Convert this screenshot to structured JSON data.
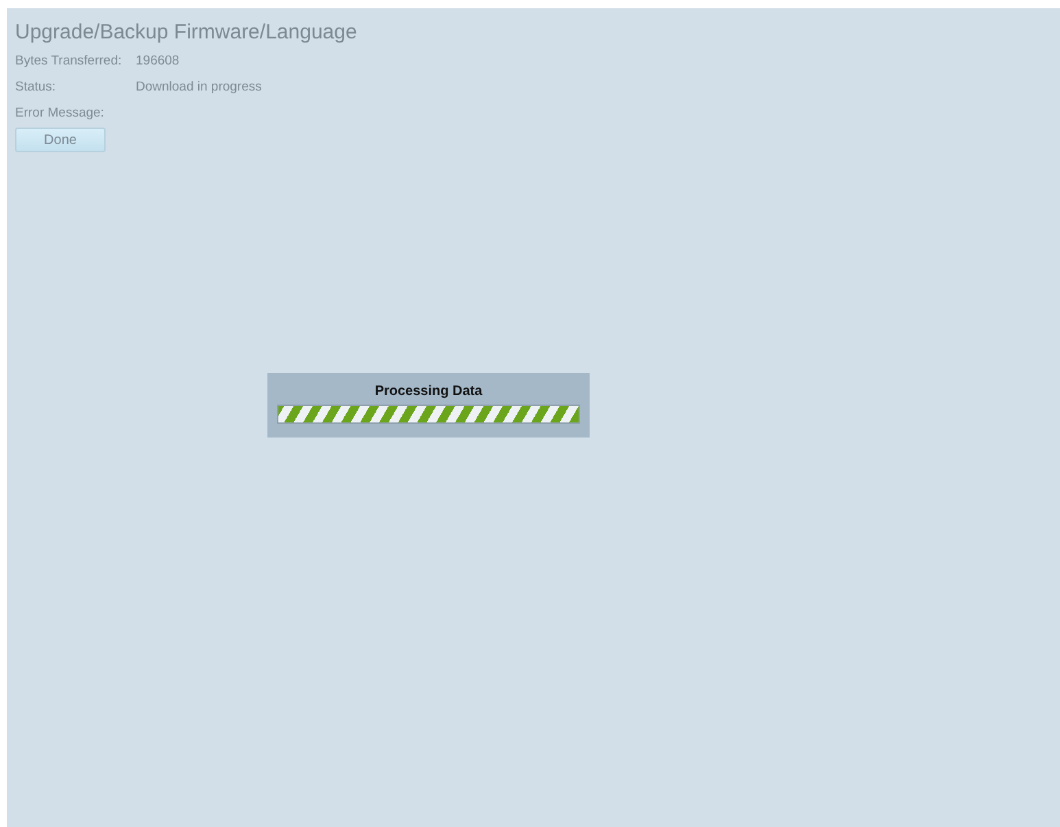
{
  "page": {
    "title": "Upgrade/Backup Firmware/Language",
    "fields": [
      {
        "label": "Bytes Transferred:",
        "value": "196608"
      },
      {
        "label": "Status:",
        "value": "Download in progress"
      },
      {
        "label": "Error Message:"
      }
    ],
    "buttons": [
      {
        "label": "Done",
        "disabled": true
      }
    ]
  },
  "dialog": {
    "title": "Processing Data",
    "progress": {
      "level": 1
    }
  }
}
